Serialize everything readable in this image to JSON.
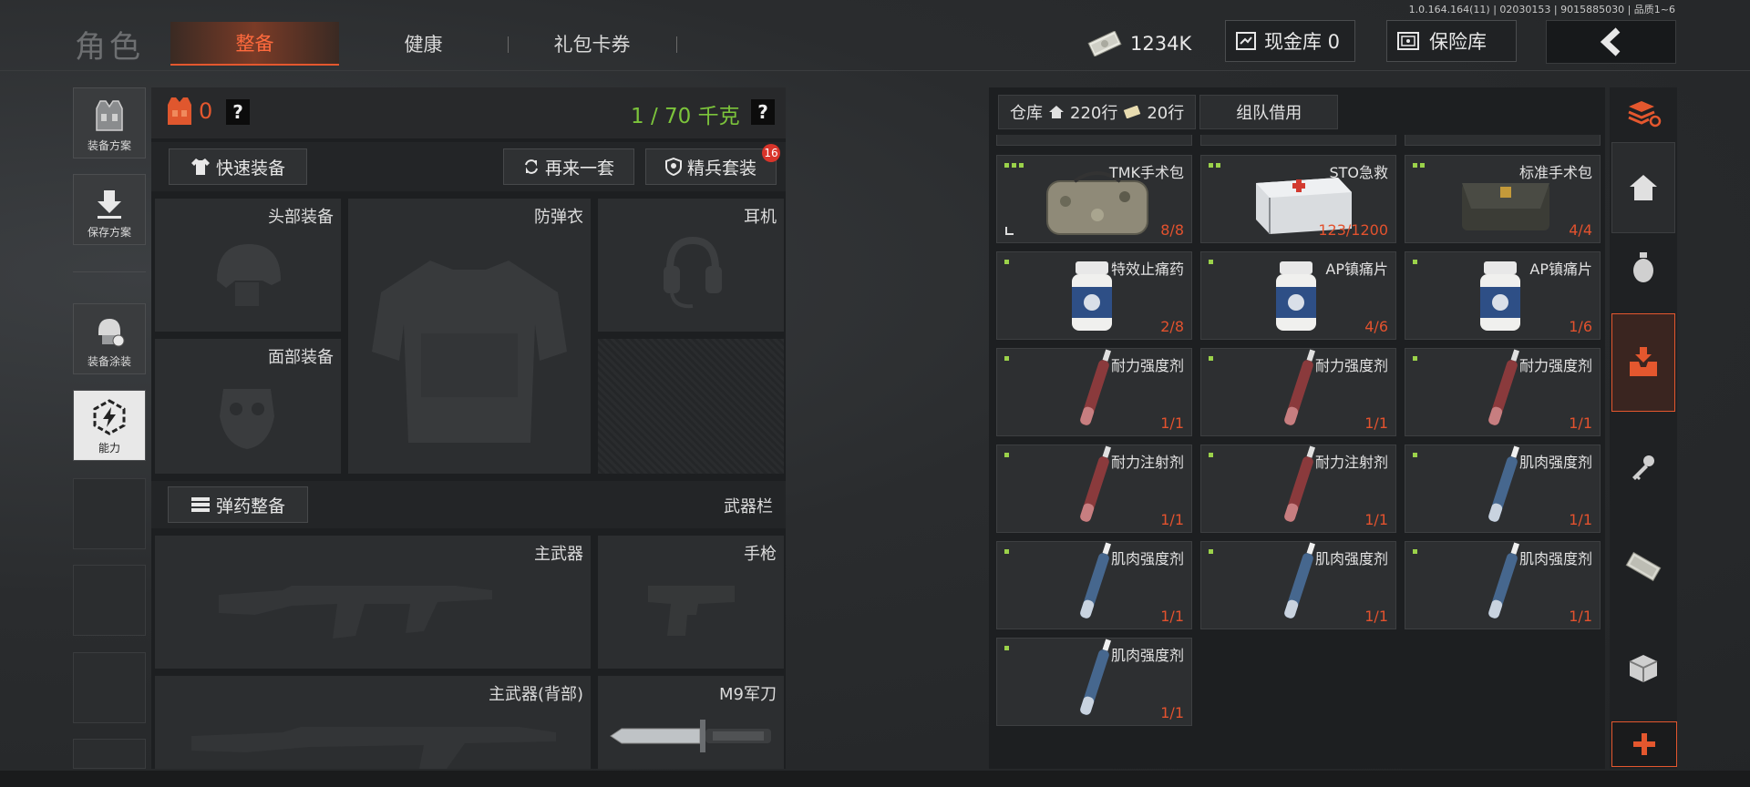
{
  "version": "1.0.164.164(11) | 02030153 | 9015885030 | 品质1~6",
  "header": {
    "title": "角色",
    "tabs": [
      "整备",
      "健康",
      "礼包卡券"
    ],
    "active_tab": "整备",
    "money": "1234K",
    "cash_vault": "现金库 0",
    "safe_box": "保险库"
  },
  "sidebar": {
    "items": [
      "装备方案",
      "保存方案",
      "装备涂装",
      "能力"
    ]
  },
  "equipment": {
    "armor_value": "0",
    "help": "?",
    "weight": "1 / 70 千克",
    "quick_equip": "快速装备",
    "again": "再来一套",
    "elite_set": "精兵套装",
    "elite_badge": "16",
    "slots": {
      "head": "头部装备",
      "vest": "防弹衣",
      "earphone": "耳机",
      "face": "面部装备",
      "primary": "主武器",
      "pistol": "手枪",
      "primary_back": "主武器(背部)",
      "knife": "M9军刀"
    },
    "ammo_button": "弹药整备",
    "weapon_bar": "武器栏"
  },
  "warehouse": {
    "tab_main": "仓库",
    "rows_home": "220行",
    "rows_ticket": "20行",
    "tab_team": "组队借用",
    "items": [
      {
        "name": "TMK手术包",
        "count": "8/8",
        "dots": 3,
        "kind": "bag"
      },
      {
        "name": "STO急救",
        "count": "123/1200",
        "dots": 2,
        "kind": "box"
      },
      {
        "name": "标准手术包",
        "count": "4/4",
        "dots": 2,
        "kind": "pouch"
      },
      {
        "name": "特效止痛药",
        "count": "2/8",
        "dots": 1,
        "kind": "bottle"
      },
      {
        "name": "AP镇痛片",
        "count": "4/6",
        "dots": 1,
        "kind": "bottle"
      },
      {
        "name": "AP镇痛片",
        "count": "1/6",
        "dots": 1,
        "kind": "bottle"
      },
      {
        "name": "耐力强度剂",
        "count": "1/1",
        "dots": 1,
        "kind": "red"
      },
      {
        "name": "耐力强度剂",
        "count": "1/1",
        "dots": 1,
        "kind": "red"
      },
      {
        "name": "耐力强度剂",
        "count": "1/1",
        "dots": 1,
        "kind": "red"
      },
      {
        "name": "耐力注射剂",
        "count": "1/1",
        "dots": 1,
        "kind": "red"
      },
      {
        "name": "耐力注射剂",
        "count": "1/1",
        "dots": 1,
        "kind": "red"
      },
      {
        "name": "肌肉强度剂",
        "count": "1/1",
        "dots": 1,
        "kind": "blue"
      },
      {
        "name": "肌肉强度剂",
        "count": "1/1",
        "dots": 1,
        "kind": "blue"
      },
      {
        "name": "肌肉强度剂",
        "count": "1/1",
        "dots": 1,
        "kind": "blue"
      },
      {
        "name": "肌肉强度剂",
        "count": "1/1",
        "dots": 1,
        "kind": "blue"
      },
      {
        "name": "肌肉强度剂",
        "count": "1/1",
        "dots": 1,
        "kind": "blue"
      }
    ]
  },
  "rail": {
    "icons": [
      "stack-refresh-icon",
      "home-icon",
      "grenade-icon",
      "inbox-download-icon",
      "key-icon",
      "cash-icon",
      "crate-icon",
      "plus-icon"
    ],
    "active": "inbox-download-icon"
  },
  "colors": {
    "accent": "#e4572e",
    "weight": "#7cc43b",
    "count": "#e3522e",
    "dot": "#9bd24a"
  }
}
